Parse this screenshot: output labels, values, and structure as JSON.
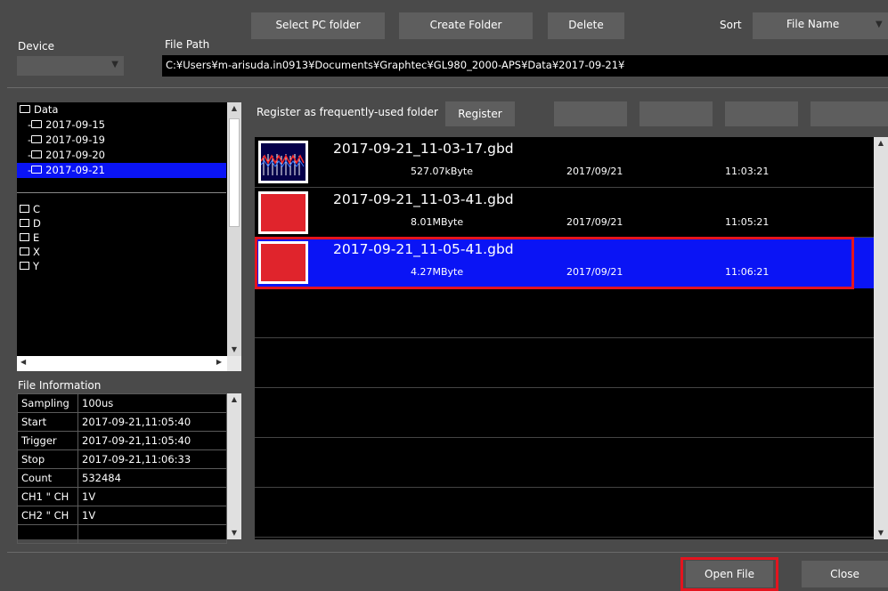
{
  "toolbar": {
    "select_pc_folder": "Select PC folder",
    "create_folder": "Create Folder",
    "delete": "Delete",
    "sort_label": "Sort",
    "sort_value": "File Name"
  },
  "device": {
    "label": "Device",
    "value": ""
  },
  "file_path": {
    "label": "File Path",
    "value": "C:¥Users¥m-arisuda.in0913¥Documents¥Graphtec¥GL980_2000-APS¥Data¥2017-09-21¥"
  },
  "tree": {
    "root": "Data",
    "folders": [
      "2017-09-15",
      "2017-09-19",
      "2017-09-20",
      "2017-09-21"
    ],
    "selected_folder": "2017-09-21",
    "drives": [
      "C",
      "D",
      "E",
      "X",
      "Y"
    ]
  },
  "register": {
    "label": "Register as frequently-used folder",
    "button": "Register"
  },
  "file_info": {
    "title": "File Information",
    "rows": [
      {
        "key": "Sampling",
        "value": "100us"
      },
      {
        "key": "Start",
        "value": "2017-09-21,11:05:40"
      },
      {
        "key": "Trigger",
        "value": "2017-09-21,11:05:40"
      },
      {
        "key": "Stop",
        "value": "2017-09-21,11:06:33"
      },
      {
        "key": "Count",
        "value": "532484"
      },
      {
        "key": "CH1 \" CH",
        "value": "1V"
      },
      {
        "key": "CH2 \" CH",
        "value": "1V"
      },
      {
        "key": "",
        "value": ""
      }
    ]
  },
  "files": [
    {
      "name": "2017-09-21_11-03-17.gbd",
      "size": "527.07kByte",
      "date": "2017/09/21",
      "time": "11:03:21",
      "thumb": "waveform",
      "selected": false
    },
    {
      "name": "2017-09-21_11-03-41.gbd",
      "size": "8.01MByte",
      "date": "2017/09/21",
      "time": "11:05:21",
      "thumb": "red",
      "selected": false
    },
    {
      "name": "2017-09-21_11-05-41.gbd",
      "size": "4.27MByte",
      "date": "2017/09/21",
      "time": "11:06:21",
      "thumb": "red",
      "selected": true
    }
  ],
  "footer": {
    "open_file": "Open File",
    "close": "Close"
  },
  "colors": {
    "selection": "#0a14f5",
    "highlight_border": "#e4141e",
    "thumb_red": "#e0242c"
  }
}
